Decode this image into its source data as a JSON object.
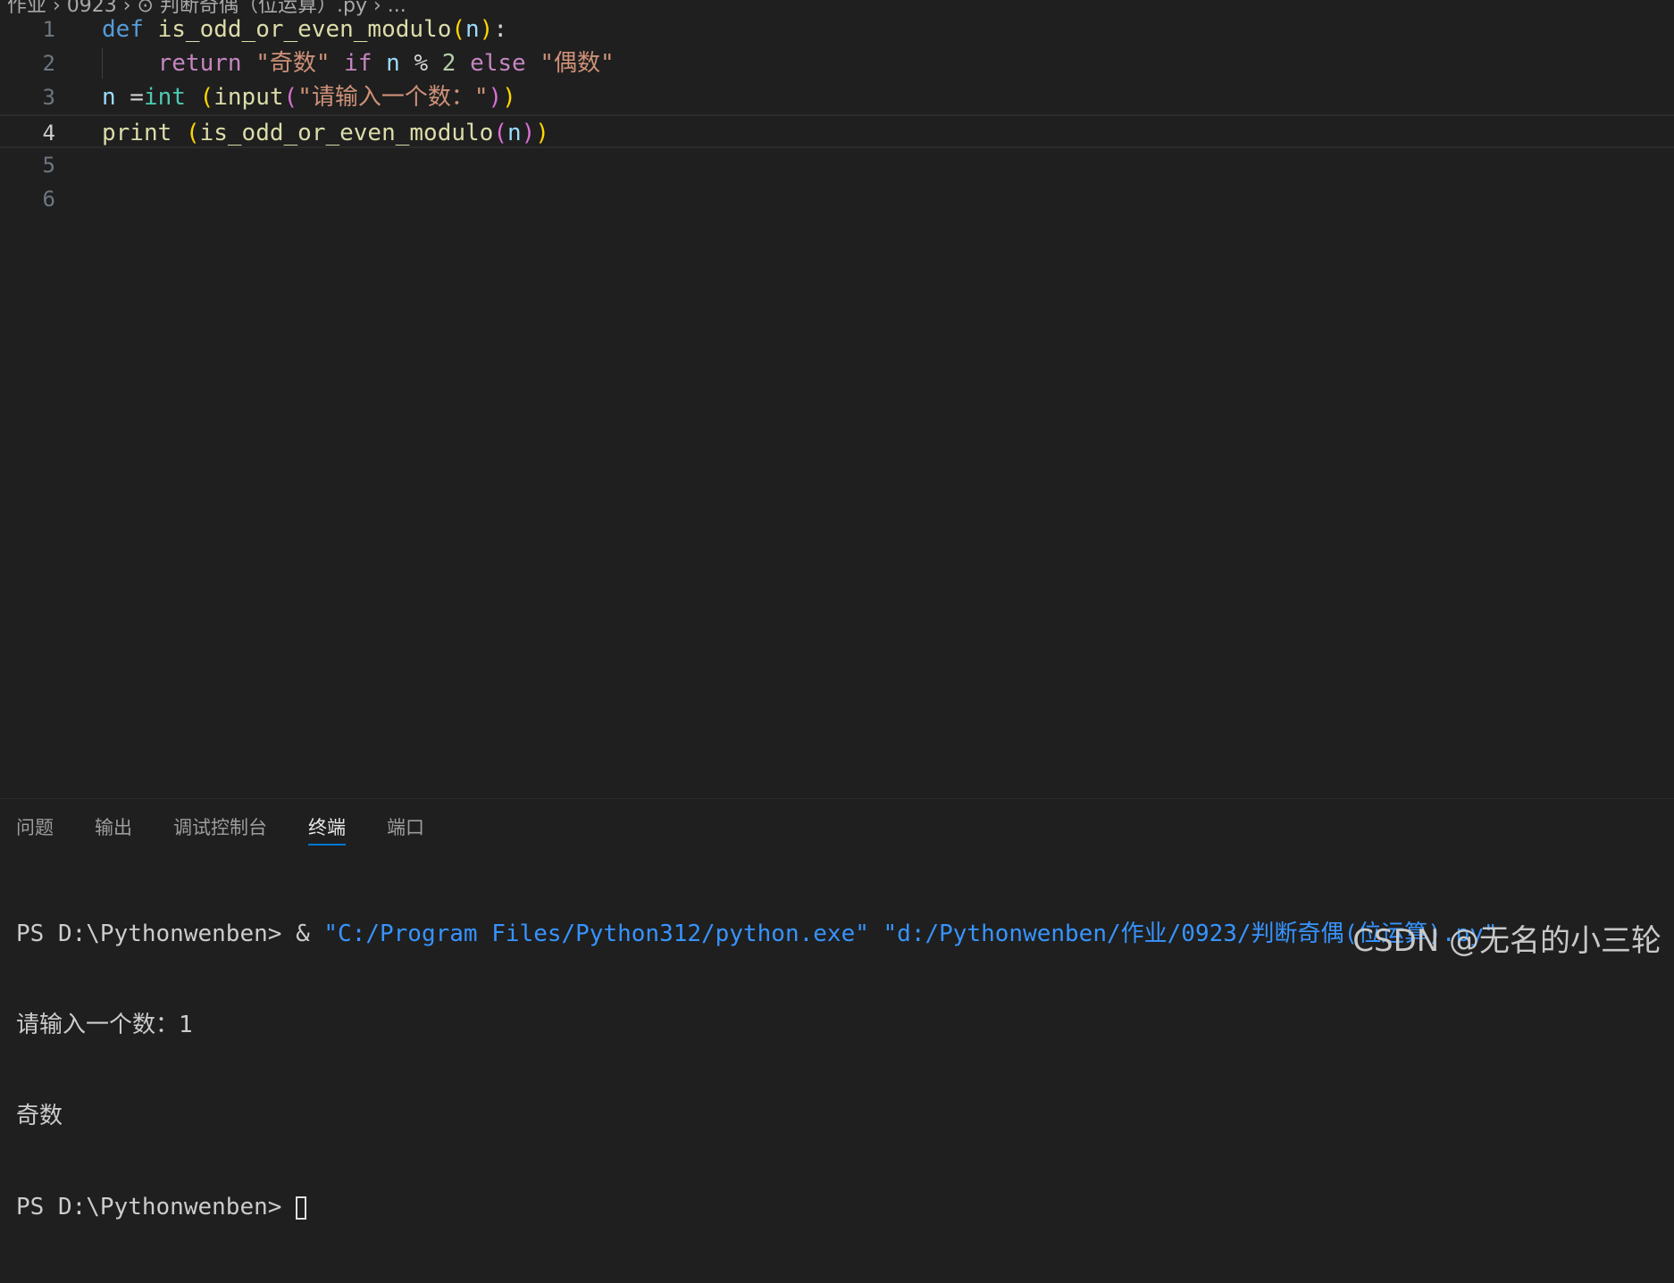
{
  "breadcrumb": "作业 › 0923 › ⊙ 判断奇偶（位运算）.py › ...",
  "editor": {
    "active_line": 4,
    "lines": [
      {
        "number": "1",
        "tokens": [
          {
            "t": "def",
            "c": "kw"
          },
          {
            "t": " ",
            "c": "op"
          },
          {
            "t": "is_odd_or_even_modulo",
            "c": "fn"
          },
          {
            "t": "(",
            "c": "b1"
          },
          {
            "t": "n",
            "c": "var"
          },
          {
            "t": ")",
            "c": "b1"
          },
          {
            "t": ":",
            "c": "op"
          }
        ]
      },
      {
        "number": "2",
        "tokens": [
          {
            "t": "    ",
            "c": "op"
          },
          {
            "t": "return",
            "c": "ctl"
          },
          {
            "t": " ",
            "c": "op"
          },
          {
            "t": "\"奇数\"",
            "c": "str"
          },
          {
            "t": " ",
            "c": "op"
          },
          {
            "t": "if",
            "c": "ctl"
          },
          {
            "t": " ",
            "c": "op"
          },
          {
            "t": "n",
            "c": "var"
          },
          {
            "t": " % ",
            "c": "op"
          },
          {
            "t": "2",
            "c": "num"
          },
          {
            "t": " ",
            "c": "op"
          },
          {
            "t": "else",
            "c": "ctl"
          },
          {
            "t": " ",
            "c": "op"
          },
          {
            "t": "\"偶数\"",
            "c": "str"
          }
        ]
      },
      {
        "number": "3",
        "tokens": [
          {
            "t": "n",
            "c": "var"
          },
          {
            "t": " =",
            "c": "op"
          },
          {
            "t": "int",
            "c": "cls"
          },
          {
            "t": " ",
            "c": "op"
          },
          {
            "t": "(",
            "c": "b1"
          },
          {
            "t": "input",
            "c": "fn"
          },
          {
            "t": "(",
            "c": "b2"
          },
          {
            "t": "\"请输入一个数：\"",
            "c": "str"
          },
          {
            "t": ")",
            "c": "b2"
          },
          {
            "t": ")",
            "c": "b1"
          }
        ]
      },
      {
        "number": "4",
        "tokens": [
          {
            "t": "print",
            "c": "fn"
          },
          {
            "t": " ",
            "c": "op"
          },
          {
            "t": "(",
            "c": "b1"
          },
          {
            "t": "is_odd_or_even_modulo",
            "c": "fn"
          },
          {
            "t": "(",
            "c": "b2"
          },
          {
            "t": "n",
            "c": "var"
          },
          {
            "t": ")",
            "c": "b2"
          },
          {
            "t": ")",
            "c": "b1"
          }
        ]
      },
      {
        "number": "5",
        "tokens": []
      },
      {
        "number": "6",
        "tokens": []
      }
    ]
  },
  "panel": {
    "tabs": [
      {
        "label": "问题",
        "name": "tab-problems",
        "active": false
      },
      {
        "label": "输出",
        "name": "tab-output",
        "active": false
      },
      {
        "label": "调试控制台",
        "name": "tab-debug-console",
        "active": false
      },
      {
        "label": "终端",
        "name": "tab-terminal",
        "active": true
      },
      {
        "label": "端口",
        "name": "tab-ports",
        "active": false
      }
    ],
    "terminal": {
      "prompt": "PS D:\\Pythonwenben> ",
      "command_op": "& ",
      "command_exe": "\"C:/Program Files/Python312/python.exe\"",
      "command_script": "\"d:/Pythonwenben/作业/0923/判断奇偶(位运算).py\"",
      "input_line": "请输入一个数：1",
      "output_line": "奇数",
      "final_prompt": "PS D:\\Pythonwenben> "
    }
  },
  "watermark": "CSDN @无名的小三轮"
}
